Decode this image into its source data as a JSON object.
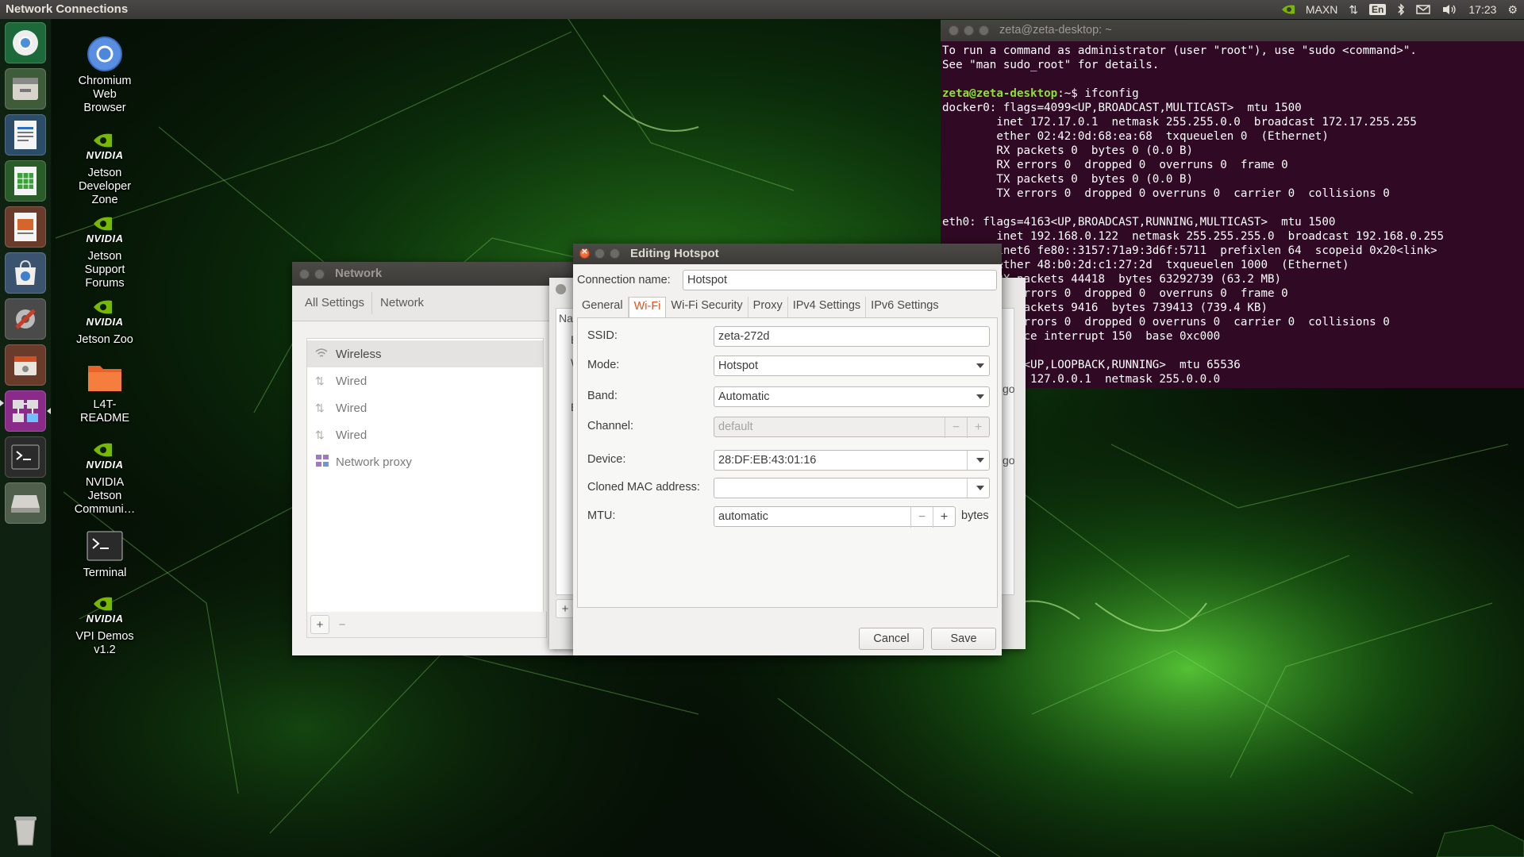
{
  "panel": {
    "title": "Network Connections",
    "indicators": {
      "power_mode": "MAXN",
      "keyboard": "En",
      "clock": "17:23"
    }
  },
  "launcher": {
    "items": [
      "chromium-icon",
      "files-icon",
      "writer-icon",
      "calc-icon",
      "impress-icon",
      "software-icon",
      "settings-icon",
      "disks-icon",
      "network-icon",
      "terminal-icon",
      "drive-icon",
      "trash-icon"
    ]
  },
  "desktop": {
    "icons": [
      {
        "label": "Chromium\nWeb\nBrowser"
      },
      {
        "label": "Jetson\nDeveloper\nZone",
        "brand": "NVIDIA"
      },
      {
        "label": "Jetson\nSupport\nForums",
        "brand": "NVIDIA"
      },
      {
        "label": "Jetson Zoo",
        "brand": "NVIDIA"
      },
      {
        "label": "L4T-\nREADME"
      },
      {
        "label": "NVIDIA\nJetson\nCommuni…",
        "brand": "NVIDIA"
      },
      {
        "label": "Terminal"
      },
      {
        "label": "VPI Demos\nv1.2",
        "brand": "NVIDIA"
      }
    ]
  },
  "terminal": {
    "title": "zeta@zeta-desktop: ~",
    "lines": [
      "To run a command as administrator (user \"root\"), use \"sudo <command>\".",
      "See \"man sudo_root\" for details.",
      "",
      "docker0: flags=4099<UP,BROADCAST,MULTICAST>  mtu 1500",
      "        inet 172.17.0.1  netmask 255.255.0.0  broadcast 172.17.255.255",
      "        ether 02:42:0d:68:ea:68  txqueuelen 0  (Ethernet)",
      "        RX packets 0  bytes 0 (0.0 B)",
      "        RX errors 0  dropped 0  overruns 0  frame 0",
      "        TX packets 0  bytes 0 (0.0 B)",
      "        TX errors 0  dropped 0 overruns 0  carrier 0  collisions 0",
      "",
      "eth0: flags=4163<UP,BROADCAST,RUNNING,MULTICAST>  mtu 1500",
      "        inet 192.168.0.122  netmask 255.255.255.0  broadcast 192.168.0.255",
      "        inet6 fe80::3157:71a9:3d6f:5711  prefixlen 64  scopeid 0x20<link>",
      "        ether 48:b0:2d:c1:27:2d  txqueuelen 1000  (Ethernet)",
      "        RX packets 44418  bytes 63292739 (63.2 MB)",
      "        RX errors 0  dropped 0  overruns 0  frame 0",
      "        TX packets 9416  bytes 739413 (739.4 KB)",
      "        TX errors 0  dropped 0 overruns 0  carrier 0  collisions 0",
      "        device interrupt 150  base 0xc000",
      "",
      "lo: flags=73<UP,LOOPBACK,RUNNING>  mtu 65536",
      "        inet 127.0.0.1  netmask 255.0.0.0"
    ],
    "prompt_user": "zeta@zeta-desktop",
    "prompt_sep": ":~$ ",
    "command": "ifconfig"
  },
  "network_window": {
    "title": "Network",
    "breadcrumbs": [
      "All Settings",
      "Network"
    ],
    "items": [
      {
        "label": "Wireless",
        "icon": "wifi-icon",
        "selected": true
      },
      {
        "label": "Wired",
        "icon": "wired-icon"
      },
      {
        "label": "Wired",
        "icon": "wired-icon"
      },
      {
        "label": "Wired",
        "icon": "wired-icon"
      },
      {
        "label": "Network proxy",
        "icon": "proxy-icon"
      }
    ],
    "add": "+",
    "remove": "−"
  },
  "conn_window": {
    "header_fragment": "Na",
    "section_letters": [
      "E",
      "W",
      "E"
    ],
    "time_fragments": [
      "go",
      "go"
    ],
    "add": "+"
  },
  "edit_dialog": {
    "title": "Editing Hotspot",
    "connection_name_label": "Connection name:",
    "connection_name": "Hotspot",
    "tabs": [
      "General",
      "Wi-Fi",
      "Wi-Fi Security",
      "Proxy",
      "IPv4 Settings",
      "IPv6 Settings"
    ],
    "active_tab": "Wi-Fi",
    "fields": {
      "ssid_label": "SSID:",
      "ssid": "zeta-272d",
      "mode_label": "Mode:",
      "mode": "Hotspot",
      "band_label": "Band:",
      "band": "Automatic",
      "channel_label": "Channel:",
      "channel_placeholder": "default",
      "device_label": "Device:",
      "device": "28:DF:EB:43:01:16",
      "cloned_mac_label": "Cloned MAC address:",
      "cloned_mac": "",
      "mtu_label": "MTU:",
      "mtu": "automatic",
      "mtu_unit": "bytes",
      "minus": "−",
      "plus": "+"
    },
    "cancel": "Cancel",
    "save": "Save"
  },
  "colors": {
    "accent": "#e2541e",
    "terminal_bg": "#300a24",
    "prompt_green": "#8ae234",
    "prompt_blue": "#729fcf"
  }
}
